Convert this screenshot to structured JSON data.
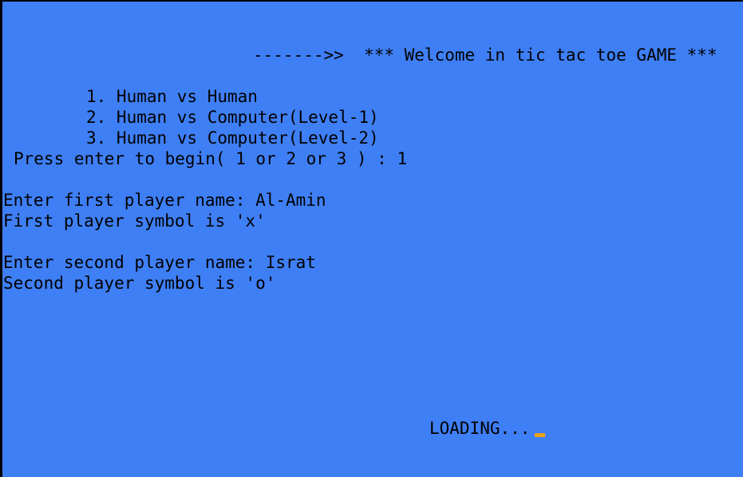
{
  "title_line": "------->>  *** Welcome in tic tac toe GAME ***",
  "menu": {
    "option_1": "1. Human vs Human",
    "option_2": "2. Human vs Computer(Level-1)",
    "option_3": "3. Human vs Computer(Level-2)"
  },
  "prompt": {
    "label": "Press enter to begin( 1 or 2 or 3 ) : ",
    "value": "1"
  },
  "player_one": {
    "prompt": "Enter first player name: ",
    "name": "Al-Amin",
    "symbol_line": "First player symbol is 'x'"
  },
  "player_two": {
    "prompt": "Enter second player name: ",
    "name": "Israt",
    "symbol_line": "Second player symbol is 'o'"
  },
  "loading_text": "LOADING...",
  "colors": {
    "background": "#3f7ff5",
    "text": "#000000",
    "cursor": "#e8a21a"
  }
}
